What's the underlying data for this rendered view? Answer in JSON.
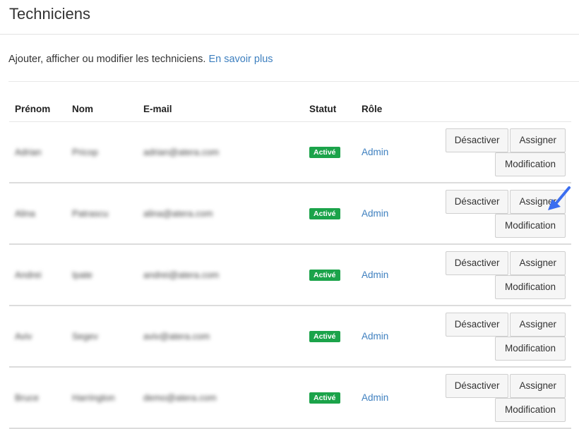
{
  "header": {
    "title": "Techniciens"
  },
  "description": {
    "text": "Ajouter, afficher ou modifier les techniciens. ",
    "link": "En savoir plus"
  },
  "table": {
    "columns": [
      "Prénom",
      "Nom",
      "E-mail",
      "Statut",
      "Rôle",
      ""
    ],
    "rows": [
      {
        "first": "Adrian",
        "last": "Pricop",
        "email": "adrian@atera.com",
        "status": "Activé",
        "role": "Admin",
        "btn_deactivate": "Désactiver",
        "btn_assign": "Assigner",
        "btn_edit": "Modification"
      },
      {
        "first": "Alina",
        "last": "Patrascu",
        "email": "alina@atera.com",
        "status": "Activé",
        "role": "Admin",
        "btn_deactivate": "Désactiver",
        "btn_assign": "Assigner",
        "btn_edit": "Modification"
      },
      {
        "first": "Andrei",
        "last": "Ipate",
        "email": "andrei@atera.com",
        "status": "Activé",
        "role": "Admin",
        "btn_deactivate": "Désactiver",
        "btn_assign": "Assigner",
        "btn_edit": "Modification"
      },
      {
        "first": "Aviv",
        "last": "Segev",
        "email": "aviv@atera.com",
        "status": "Activé",
        "role": "Admin",
        "btn_deactivate": "Désactiver",
        "btn_assign": "Assigner",
        "btn_edit": "Modification"
      },
      {
        "first": "Bruce",
        "last": "Harrington",
        "email": "demo@atera.com",
        "status": "Activé",
        "role": "Admin",
        "btn_deactivate": "Désactiver",
        "btn_assign": "Assigner",
        "btn_edit": "Modification"
      }
    ]
  },
  "colors": {
    "accent_link": "#3d7fbf",
    "status_active": "#1ba34a",
    "annotation_arrow": "#3b6ef0"
  }
}
